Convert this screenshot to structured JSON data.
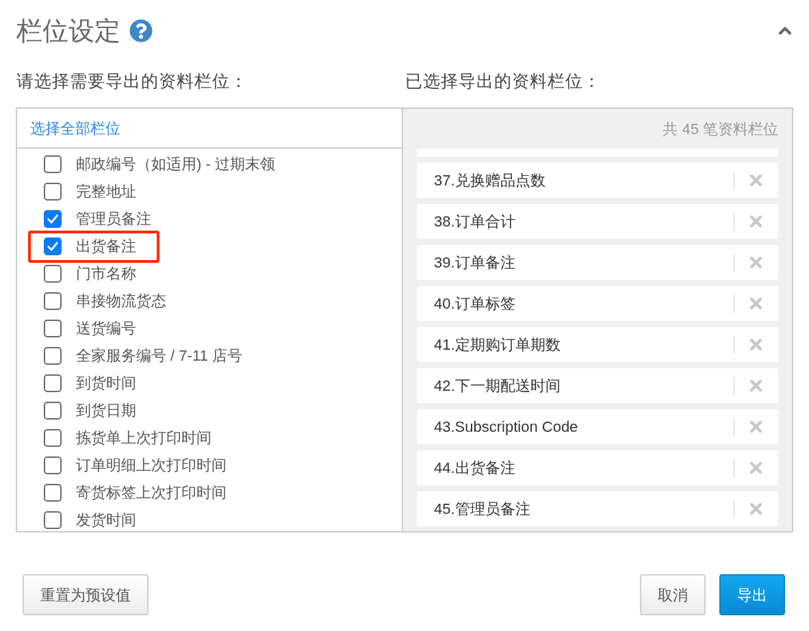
{
  "header": {
    "title": "栏位设定",
    "expanded": true
  },
  "available": {
    "heading": "请选择需要导出的资料栏位：",
    "select_all": "选择全部栏位",
    "fields": [
      {
        "label": "邮政编号（如适用) - 过期末领",
        "checked": false,
        "highlighted": false
      },
      {
        "label": "完整地址",
        "checked": false,
        "highlighted": false
      },
      {
        "label": "管理员备注",
        "checked": true,
        "highlighted": false
      },
      {
        "label": "出货备注",
        "checked": true,
        "highlighted": true
      },
      {
        "label": "门市名称",
        "checked": false,
        "highlighted": false
      },
      {
        "label": "串接物流货态",
        "checked": false,
        "highlighted": false
      },
      {
        "label": "送货编号",
        "checked": false,
        "highlighted": false
      },
      {
        "label": "全家服务编号 / 7-11 店号",
        "checked": false,
        "highlighted": false
      },
      {
        "label": "到货时间",
        "checked": false,
        "highlighted": false
      },
      {
        "label": "到货日期",
        "checked": false,
        "highlighted": false
      },
      {
        "label": "拣货单上次打印时间",
        "checked": false,
        "highlighted": false
      },
      {
        "label": "订单明细上次打印时间",
        "checked": false,
        "highlighted": false
      },
      {
        "label": "寄货标签上次打印时间",
        "checked": false,
        "highlighted": false
      },
      {
        "label": "发货时间",
        "checked": false,
        "highlighted": false
      }
    ]
  },
  "selected": {
    "heading": "已选择导出的资料栏位：",
    "count": "共 45 笔资料栏位",
    "fields": [
      {
        "label": "37.兑换赠品点数"
      },
      {
        "label": "38.订单合计"
      },
      {
        "label": "39.订单备注"
      },
      {
        "label": "40.订单标签"
      },
      {
        "label": "41.定期购订单期数"
      },
      {
        "label": "42.下一期配送时间"
      },
      {
        "label": "43.Subscription Code"
      },
      {
        "label": "44.出货备注"
      },
      {
        "label": "45.管理员备注"
      }
    ]
  },
  "footer": {
    "left_buttons": [
      {
        "label": "重置为预设值",
        "kind": "default"
      }
    ],
    "right_buttons": [
      {
        "label": "取消",
        "kind": "default"
      },
      {
        "label": "导出",
        "kind": "primary"
      }
    ]
  }
}
